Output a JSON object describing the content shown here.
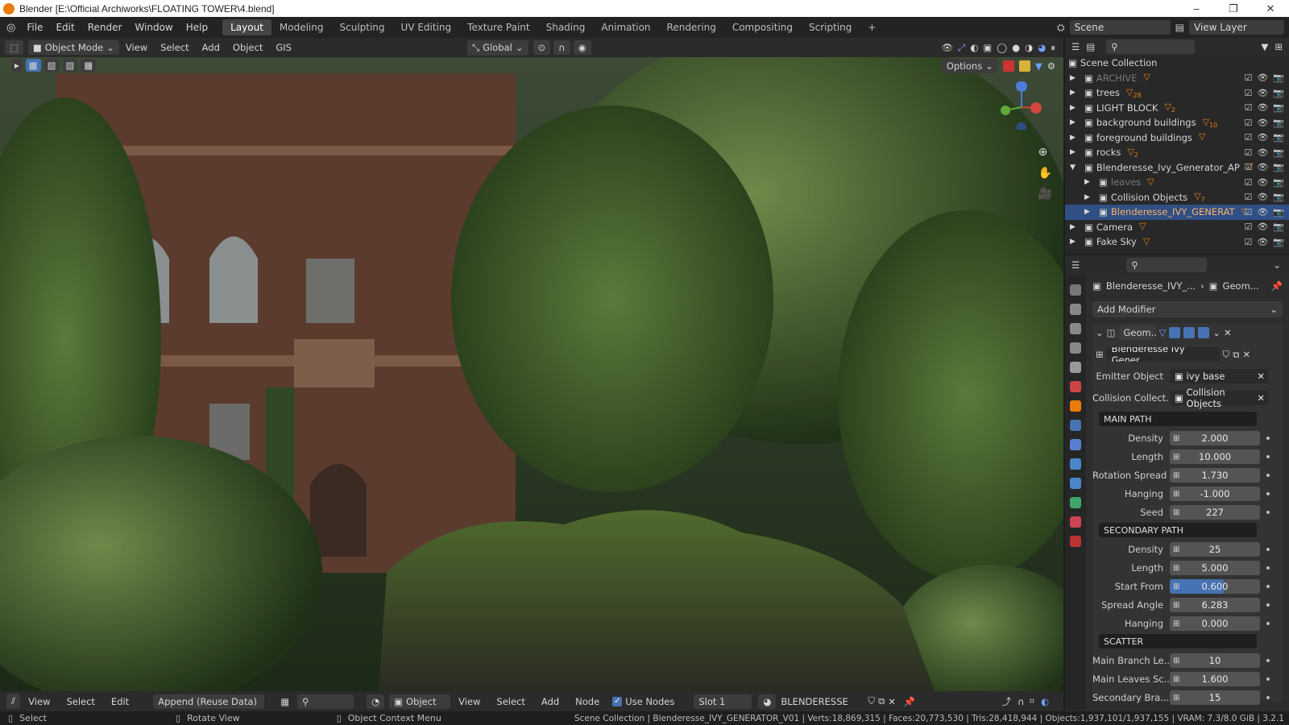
{
  "titlebar": {
    "title": "Blender [E:\\Official Archiworks\\FLOATING TOWER\\4.blend]",
    "minimize": "–",
    "maximize": "❐",
    "close": "✕"
  },
  "topbar": {
    "menus": [
      "File",
      "Edit",
      "Render",
      "Window",
      "Help"
    ],
    "workspaces": [
      "Layout",
      "Modeling",
      "Sculpting",
      "UV Editing",
      "Texture Paint",
      "Shading",
      "Animation",
      "Rendering",
      "Compositing",
      "Scripting"
    ],
    "active_workspace": "Layout",
    "add": "+",
    "scene": "Scene",
    "view_layer": "View Layer"
  },
  "viewport_header": {
    "mode": "Object Mode",
    "menus": [
      "View",
      "Select",
      "Add",
      "Object",
      "GIS"
    ],
    "transform_orientation": "Global",
    "options": "Options"
  },
  "outliner": {
    "root": "Scene Collection",
    "items": [
      {
        "name": "ARCHIVE",
        "indent": 0,
        "badge": "",
        "dim": true
      },
      {
        "name": "trees",
        "indent": 0,
        "badge": "28"
      },
      {
        "name": "LIGHT BLOCK",
        "indent": 0,
        "badge": "2"
      },
      {
        "name": "background buildings",
        "indent": 0,
        "badge": "10"
      },
      {
        "name": "foreground buildings",
        "indent": 0,
        "badge": ""
      },
      {
        "name": "rocks",
        "indent": 0,
        "badge": "2"
      },
      {
        "name": "Blenderesse_Ivy_Generator_AP",
        "indent": 0,
        "badge": "",
        "open": true
      },
      {
        "name": "leaves",
        "indent": 1,
        "badge": "",
        "dim": true
      },
      {
        "name": "Collision Objects",
        "indent": 1,
        "badge": "7"
      },
      {
        "name": "Blenderesse_IVY_GENERAT",
        "indent": 1,
        "badge": "",
        "selected": true
      },
      {
        "name": "Camera",
        "indent": 0,
        "badge": ""
      },
      {
        "name": "Fake Sky",
        "indent": 0,
        "badge": ""
      }
    ]
  },
  "properties": {
    "breadcrumb_object": "Blenderesse_IVY_...",
    "breadcrumb_modifier": "Geom...",
    "add_modifier": "Add Modifier",
    "modifier_name": "Geom...",
    "node_group": "Blenderesse Ivy Gener...",
    "emitter_label": "Emitter Object",
    "emitter_value": "ivy base",
    "collision_label": "Collision Collect...",
    "collision_value": "Collision Objects",
    "main_path": {
      "title": "MAIN PATH",
      "rows": [
        {
          "label": "Density",
          "value": "2.000"
        },
        {
          "label": "Length",
          "value": "10.000"
        },
        {
          "label": "Rotation Spread",
          "value": "1.730"
        },
        {
          "label": "Hanging",
          "value": "-1.000"
        },
        {
          "label": "Seed",
          "value": "227"
        }
      ]
    },
    "secondary_path": {
      "title": "SECONDARY PATH",
      "rows": [
        {
          "label": "Density",
          "value": "25"
        },
        {
          "label": "Length",
          "value": "5.000"
        },
        {
          "label": "Start From",
          "value": "0.600",
          "fill": 0.6
        },
        {
          "label": "Spread Angle",
          "value": "6.283"
        },
        {
          "label": "Hanging",
          "value": "0.000"
        }
      ]
    },
    "scatter": {
      "title": "SCATTER",
      "rows": [
        {
          "label": "Main Branch Le...",
          "value": "10"
        },
        {
          "label": "Main Leaves Sc...",
          "value": "1.600"
        },
        {
          "label": "Secondary Bra...",
          "value": "15"
        }
      ]
    }
  },
  "bottom_header": {
    "menus": [
      "View",
      "Select",
      "Edit"
    ],
    "append": "Append (Reuse Data)",
    "object": "Object",
    "menus2": [
      "View",
      "Select",
      "Add",
      "Node"
    ],
    "use_nodes": "Use Nodes",
    "slot": "Slot 1",
    "material": "BLENDERESSE"
  },
  "statusbar": {
    "select": "Select",
    "rotate": "Rotate View",
    "context": "Object Context Menu",
    "stats": "Scene Collection | Blenderesse_IVY_GENERATOR_V01 | Verts:18,869,315 | Faces:20,773,530 | Tris:28,418,944 | Objects:1,937,101/1,937,155 | VRAM: 7.3/8.0 GiB | 3.2.1"
  },
  "colors": {
    "accent": "#4772b3",
    "selected_row": "#2f4f85",
    "orange": "#e87d0d"
  }
}
